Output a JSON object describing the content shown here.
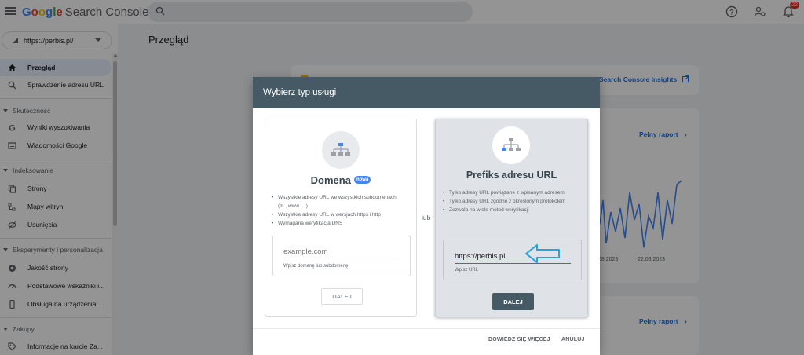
{
  "app": {
    "logo_google": "Google",
    "logo_product": "Search Console",
    "notifications_count": "22"
  },
  "property": {
    "name": "https://perbis.pl/"
  },
  "sidebar": {
    "items": {
      "overview": "Przegląd",
      "url_inspection": "Sprawdzenie adresu URL",
      "search_results": "Wyniki wyszukiwania",
      "google_news": "Wiadomości Google",
      "pages": "Strony",
      "sitemaps": "Mapy witryn",
      "removals": "Usunięcia",
      "page_experience": "Jakość strony",
      "core_web_vitals": "Podstawowe wskaźniki i...",
      "mobile_usability": "Obsługa na urządzenia...",
      "product_snippets": "Informacje na karcie Za..."
    },
    "sections": {
      "performance": "Skuteczność",
      "indexing": "Indeksowanie",
      "experience": "Eksperymenty i personalizacja",
      "shopping": "Zakupy"
    }
  },
  "main": {
    "title": "Przegląd",
    "insights_link": "Search Console Insights",
    "full_report_1": "Pełny raport",
    "full_report_2": "Pełny raport",
    "chart_dates": [
      "08.2023",
      "22.08.2023"
    ]
  },
  "dialog": {
    "title": "Wybierz typ usługi",
    "or_label": "lub",
    "domain": {
      "title": "Domena",
      "badge": "nowa",
      "bullets": [
        "Wszystkie adresy URL we wszystkich subdomenach (m., www. ...)",
        "Wszystkie adresy URL w wersjach https i http",
        "Wymagana weryfikacja DNS"
      ],
      "input_placeholder": "example.com",
      "helper": "Wpisz domenę lub subdomenę",
      "button": "DALEJ"
    },
    "prefix": {
      "title": "Prefiks adresu URL",
      "bullets": [
        "Tylko adresy URL powiązane z wpisanym adresem",
        "Tylko adresy URL zgodne z określonym protokołem",
        "Zezwala na wiele metod weryfikacji"
      ],
      "input_value": "https://perbis.pl",
      "helper": "Wpisz URL",
      "button": "DALEJ"
    },
    "learn_more": "DOWIEDZ SIĘ WIĘCEJ",
    "cancel": "ANULUJ"
  },
  "colors": {
    "header": "#455a64",
    "link": "#1a73e8",
    "annotation_arrow": "#29a3dc"
  }
}
